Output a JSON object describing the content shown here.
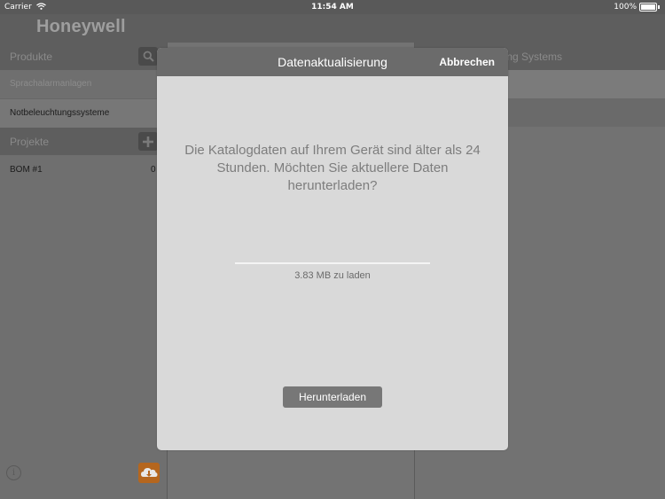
{
  "status_bar": {
    "carrier": "Carrier",
    "time": "11:54 AM",
    "battery": "100%"
  },
  "app": {
    "brand": "Honeywell"
  },
  "left_panel": {
    "products_header": "Produkte",
    "product_items": [
      {
        "label": "Sprachalarmanlagen"
      },
      {
        "label": "Notbeleuchtungssysteme"
      }
    ],
    "projects_header": "Projekte",
    "project_items": [
      {
        "label": "BOM #1",
        "count": "0"
      }
    ]
  },
  "right_panel": {
    "header_visible_text": "ering Systems"
  },
  "modal": {
    "title": "Datenaktualisierung",
    "cancel_label": "Abbrechen",
    "message": "Die Katalogdaten auf Ihrem Gerät sind älter als 24 Stunden. Möchten Sie aktuellere Daten herunterladen?",
    "progress": 0,
    "size_text": "3.83 MB zu laden",
    "download_label": "Herunterladen"
  },
  "colors": {
    "accent_orange": "#b5661e",
    "modal_bg": "#d9d9d9",
    "header_bg": "#5e5e5e"
  },
  "icons": [
    "wifi-icon",
    "battery-icon",
    "search-icon",
    "plus-icon",
    "info-icon",
    "cloud-download-icon"
  ]
}
